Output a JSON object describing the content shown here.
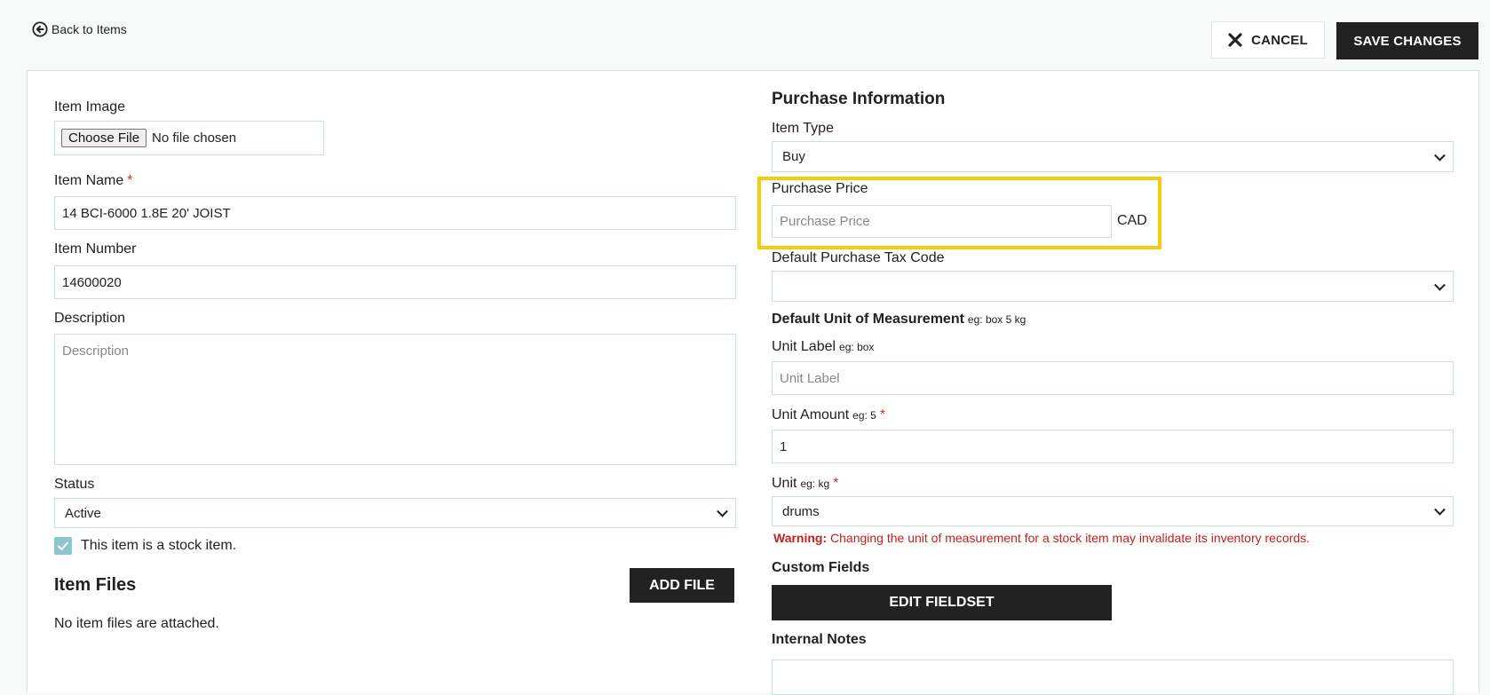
{
  "header": {
    "back_label": "Back to Items",
    "cancel_label": "CANCEL",
    "save_label": "SAVE CHANGES"
  },
  "left": {
    "item_image_label": "Item Image",
    "choose_file_label": "Choose File",
    "no_file_text": "No file chosen",
    "item_name_label": "Item Name",
    "item_name_value": "14 BCI-6000 1.8E 20' JOIST",
    "item_number_label": "Item Number",
    "item_number_value": "14600020",
    "description_label": "Description",
    "description_placeholder": "Description",
    "status_label": "Status",
    "status_value": "Active",
    "stock_checkbox_label": "This item is a stock item.",
    "stock_checked": true,
    "item_files_heading": "Item Files",
    "add_file_label": "ADD FILE",
    "no_files_text": "No item files are attached."
  },
  "right": {
    "purchase_heading": "Purchase Information",
    "item_type_label": "Item Type",
    "item_type_value": "Buy",
    "purchase_price_label": "Purchase Price",
    "purchase_price_placeholder": "Purchase Price",
    "currency": "CAD",
    "tax_code_label": "Default Purchase Tax Code",
    "tax_code_value": "",
    "uom_label": "Default Unit of Measurement",
    "uom_hint": "eg: box 5 kg",
    "unit_label_label": "Unit Label",
    "unit_label_hint": "eg: box",
    "unit_label_placeholder": "Unit Label",
    "unit_amount_label": "Unit Amount",
    "unit_amount_hint": "eg: 5",
    "unit_amount_value": "1",
    "unit_label": "Unit",
    "unit_hint": "eg: kg",
    "unit_value": "drums",
    "warning_prefix": "Warning:",
    "warning_text": "Changing the unit of measurement for a stock item may invalidate its inventory records.",
    "custom_fields_label": "Custom Fields",
    "edit_fieldset_label": "EDIT FIELDSET",
    "internal_notes_label": "Internal Notes"
  },
  "colors": {
    "highlight": "#f7cc0a",
    "dark_button": "#222222",
    "required": "#d0312d",
    "warning": "#c41e1e",
    "checkbox": "#8cc6cf"
  }
}
